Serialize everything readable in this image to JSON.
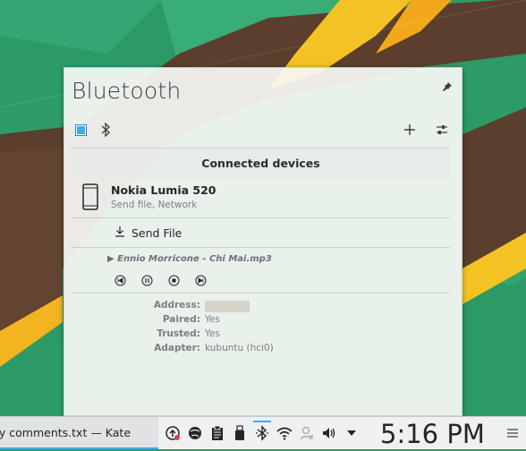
{
  "popup": {
    "title": "Bluetooth",
    "section_header": "Connected devices",
    "device": {
      "name": "Nokia Lumia 520",
      "services": "Send file, Network",
      "action_label": "Send File",
      "now_playing": "Ennio Morricone - Chi Mai.mp3",
      "details": [
        {
          "label": "Address:",
          "value": ""
        },
        {
          "label": "Paired:",
          "value": "Yes"
        },
        {
          "label": "Trusted:",
          "value": "Yes"
        },
        {
          "label": "Adapter:",
          "value": "kubuntu (hci0)"
        }
      ]
    }
  },
  "taskbar": {
    "task_title": "ty comments.txt  — Kate",
    "clock": "5:16 PM"
  },
  "colors": {
    "accent": "#3daee9",
    "text": "#232629",
    "muted": "#7a7f84"
  }
}
